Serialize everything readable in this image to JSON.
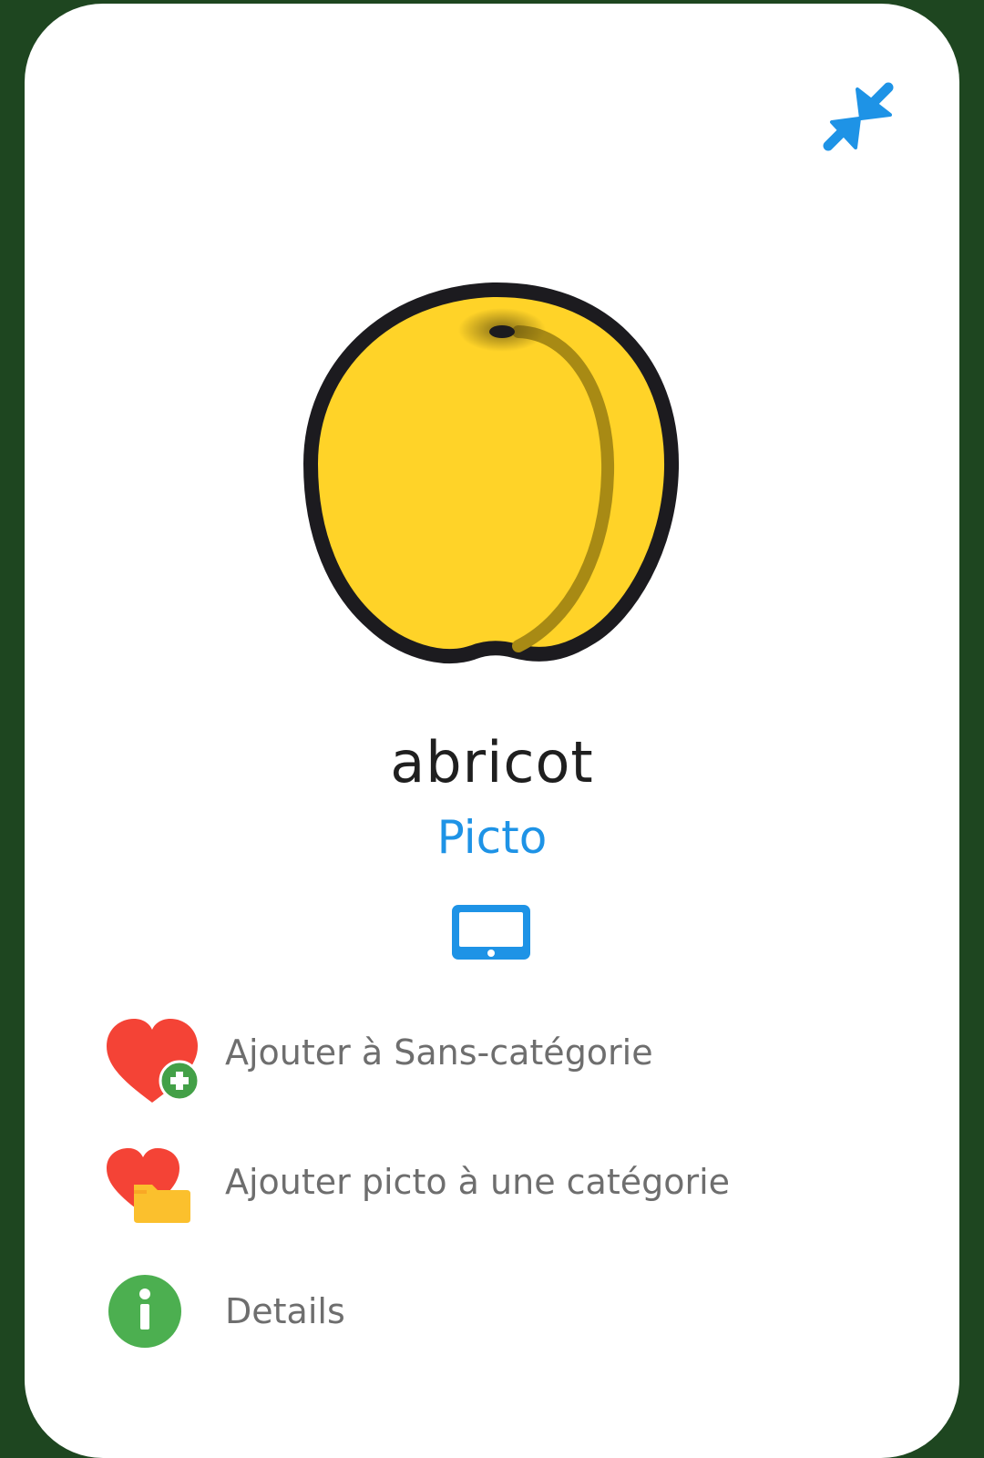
{
  "picto": {
    "word": "abricot",
    "type": "Picto"
  },
  "icons": {
    "collapse": "collapse-arrows-icon",
    "device": "tablet-icon",
    "fruit": "apricot-image"
  },
  "actions": [
    {
      "label": "Ajouter à Sans-catégorie",
      "icon": "heart-plus-icon"
    },
    {
      "label": "Ajouter picto à une catégorie",
      "icon": "heart-folder-icon"
    },
    {
      "label": "Details",
      "icon": "info-icon"
    }
  ],
  "colors": {
    "background": "#1e4620",
    "accent": "#1e93e6",
    "heart": "#f44336",
    "plus_badge": "#43a047",
    "folder": "#fbc02d",
    "info": "#4caf50",
    "fruit": "#ffd328"
  }
}
